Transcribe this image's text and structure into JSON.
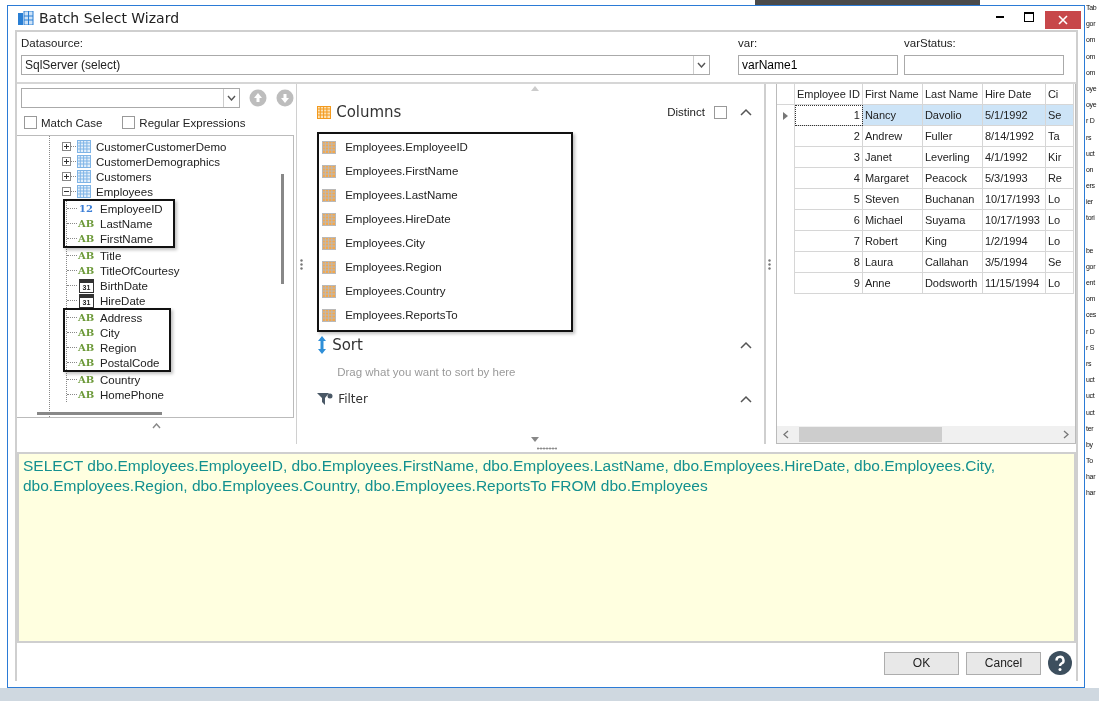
{
  "background_app": {
    "groups": [
      [
        "Tab",
        "gor",
        "om",
        "om",
        "om",
        "oye",
        "oye",
        "r D",
        "rs",
        "uct",
        "on",
        "ers",
        "ier",
        "tori"
      ],
      [
        "be",
        "gor",
        "ent",
        "om",
        "ces",
        "r D",
        "r S",
        "rs",
        "uct",
        "uct",
        "uct",
        "ter",
        "by",
        "To",
        "har",
        "har"
      ]
    ]
  },
  "window": {
    "title": "Batch Select Wizard"
  },
  "datasource": {
    "label": "Datasource:",
    "value": "SqlServer (select)"
  },
  "var": {
    "label": "var:",
    "value": "varName1"
  },
  "var_status": {
    "label": "varStatus:"
  },
  "tree_panel": {
    "options": [
      {
        "label": "Match Case",
        "checked": false
      },
      {
        "label": "Regular Expressions",
        "checked": false
      }
    ],
    "items": [
      {
        "label": "CustomerCustomerDemo",
        "expanded": false
      },
      {
        "label": "CustomerDemographics",
        "expanded": false
      },
      {
        "label": "Customers",
        "expanded": false
      },
      {
        "label": "Employees",
        "expanded": true,
        "children": [
          {
            "label": "EmployeeID",
            "kind": "number",
            "type_mark": "12",
            "framed": true
          },
          {
            "label": "LastName",
            "kind": "text",
            "type_mark": "AB",
            "framed": true
          },
          {
            "label": "FirstName",
            "kind": "text",
            "type_mark": "AB",
            "framed": true
          },
          {
            "label": "Title",
            "kind": "text",
            "type_mark": "AB",
            "framed": false
          },
          {
            "label": "TitleOfCourtesy",
            "kind": "text",
            "type_mark": "AB",
            "framed": false
          },
          {
            "label": "BirthDate",
            "kind": "date",
            "type_mark": "31",
            "framed": false
          },
          {
            "label": "HireDate",
            "kind": "date",
            "type_mark": "31",
            "framed": false
          },
          {
            "label": "Address",
            "kind": "text",
            "type_mark": "AB",
            "framed": true
          },
          {
            "label": "City",
            "kind": "text",
            "type_mark": "AB",
            "framed": true
          },
          {
            "label": "Region",
            "kind": "text",
            "type_mark": "AB",
            "framed": true
          },
          {
            "label": "PostalCode",
            "kind": "text",
            "type_mark": "AB",
            "framed": true
          },
          {
            "label": "Country",
            "kind": "text",
            "type_mark": "AB",
            "framed": false
          },
          {
            "label": "HomePhone",
            "kind": "text",
            "type_mark": "AB",
            "framed": false
          }
        ]
      }
    ]
  },
  "query_panel": {
    "columns_title": "Columns",
    "distinct": {
      "label": "Distinct",
      "checked": false
    },
    "columns_framed": true,
    "columns": [
      "Employees.EmployeeID",
      "Employees.FirstName",
      "Employees.LastName",
      "Employees.HireDate",
      "Employees.City",
      "Employees.Region",
      "Employees.Country",
      "Employees.ReportsTo"
    ],
    "sort_title": "Sort",
    "sort_hint": "Drag what you want to sort by here",
    "filter_title": "Filter"
  },
  "table": {
    "columns": [
      "Employee ID",
      "First Name",
      "Last Name",
      "Hire Date",
      "Ci"
    ],
    "rows": [
      {
        "cells": [
          "1",
          "Nancy",
          "Davolio",
          "5/1/1992",
          "Se"
        ],
        "selected": true
      },
      {
        "cells": [
          "2",
          "Andrew",
          "Fuller",
          "8/14/1992",
          "Ta"
        ],
        "selected": false
      },
      {
        "cells": [
          "3",
          "Janet",
          "Leverling",
          "4/1/1992",
          "Kir"
        ],
        "selected": false
      },
      {
        "cells": [
          "4",
          "Margaret",
          "Peacock",
          "5/3/1993",
          "Re"
        ],
        "selected": false
      },
      {
        "cells": [
          "5",
          "Steven",
          "Buchanan",
          "10/17/1993",
          "Lo"
        ],
        "selected": false
      },
      {
        "cells": [
          "6",
          "Michael",
          "Suyama",
          "10/17/1993",
          "Lo"
        ],
        "selected": false
      },
      {
        "cells": [
          "7",
          "Robert",
          "King",
          "1/2/1994",
          "Lo"
        ],
        "selected": false
      },
      {
        "cells": [
          "8",
          "Laura",
          "Callahan",
          "3/5/1994",
          "Se"
        ],
        "selected": false
      },
      {
        "cells": [
          "9",
          "Anne",
          "Dodsworth",
          "11/15/1994",
          "Lo"
        ],
        "selected": false
      }
    ]
  },
  "sql": "SELECT dbo.Employees.EmployeeID, dbo.Employees.FirstName, dbo.Employees.LastName, dbo.Employees.HireDate, dbo.Employees.City, dbo.Employees.Region, dbo.Employees.Country, dbo.Employees.ReportsTo FROM dbo.Employees",
  "buttons": [
    "OK",
    "Cancel"
  ]
}
